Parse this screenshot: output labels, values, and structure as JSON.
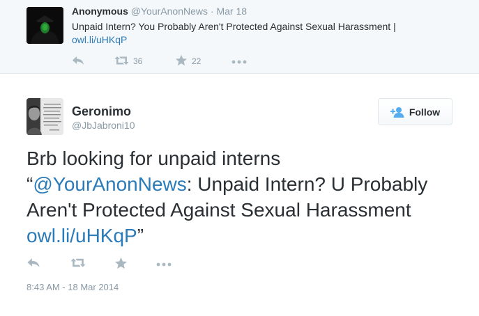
{
  "parent_tweet": {
    "name": "Anonymous",
    "handle": "@YourAnonNews",
    "separator": "·",
    "date": "Mar 18",
    "text": "Unpaid Intern? You Probably Aren't Protected Against Sexual Harassment |",
    "link": "owl.li/uHKqP",
    "retweet_count": "36",
    "favorite_count": "22"
  },
  "tweet": {
    "name": "Geronimo",
    "handle": "@JbJabroni10",
    "follow_label": "Follow",
    "text_line1": "Brb looking for unpaid interns",
    "open_quote": "“",
    "mention": "@YourAnonNews",
    "quote_text": ": Unpaid Intern? U Probably Aren't Protected Against Sexual Harassment ",
    "link": "owl.li/uHKqP",
    "close_quote": "”",
    "timestamp": "8:43 AM - 18 Mar 2014"
  },
  "icons": {
    "reply": "reply-icon",
    "retweet": "retweet-icon",
    "favorite": "star-icon",
    "more": "more-icon",
    "follow": "add-user-icon"
  },
  "colors": {
    "link": "#2b7bb9",
    "muted": "#8899a6",
    "icon": "#aab8c2",
    "parent_bg": "#f5f8fa"
  }
}
